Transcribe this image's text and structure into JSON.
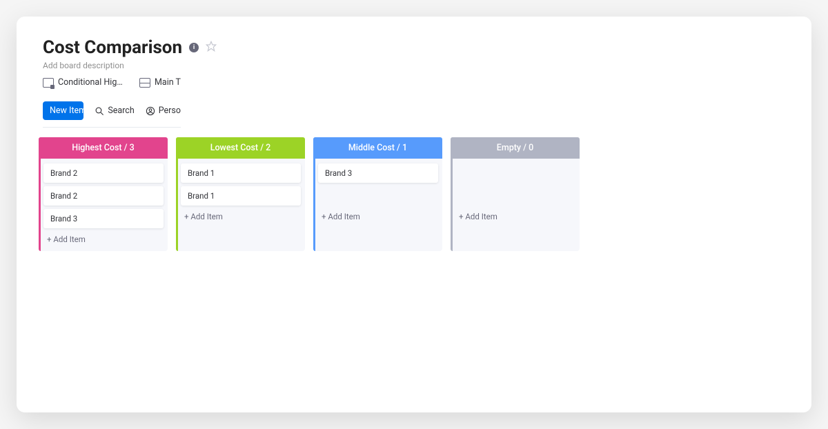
{
  "header": {
    "title": "Cost Comparison",
    "description": "Add board description"
  },
  "views": [
    {
      "label": "Conditional Highli…",
      "icon": "conditional-highlight-icon"
    },
    {
      "label": "Main Tab",
      "icon": "table-icon"
    }
  ],
  "toolbar": {
    "new_item_label": "New Item",
    "search_label": "Search",
    "person_label": "Perso"
  },
  "columns": [
    {
      "name": "Highest Cost",
      "count": 3,
      "accent": "#e2448d",
      "items": [
        "Brand 2",
        "Brand 2",
        "Brand 3"
      ],
      "add_label": "+ Add Item"
    },
    {
      "name": "Lowest Cost",
      "count": 2,
      "accent": "#9cd326",
      "items": [
        "Brand 1",
        "Brand 1"
      ],
      "add_label": "+ Add Item"
    },
    {
      "name": "Middle Cost",
      "count": 1,
      "accent": "#579bfc",
      "items": [
        "Brand 3"
      ],
      "add_label": "+ Add Item"
    },
    {
      "name": "Empty",
      "count": 0,
      "accent": "#b0b4c3",
      "items": [],
      "add_label": "+ Add Item"
    }
  ]
}
